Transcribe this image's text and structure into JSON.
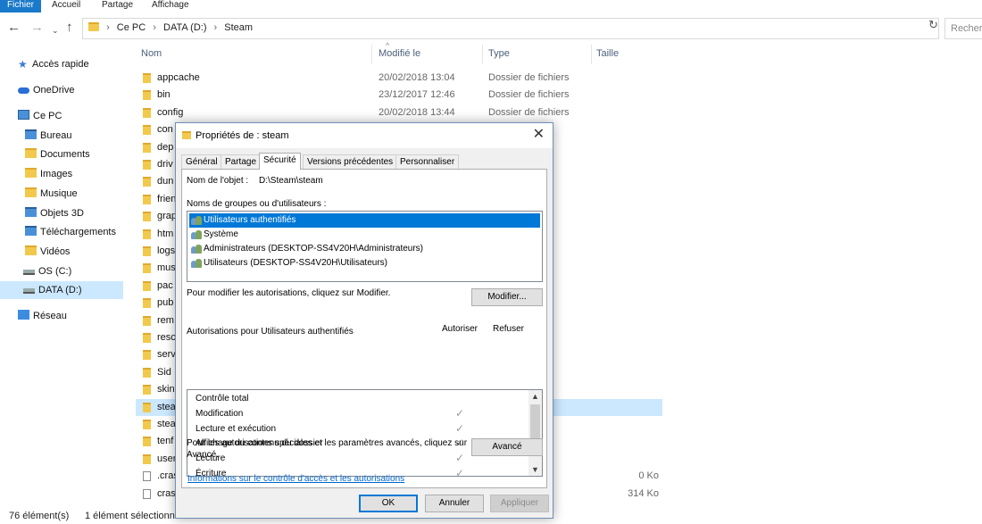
{
  "ribbon": {
    "tabs": [
      "Fichier",
      "Accueil",
      "Partage",
      "Affichage"
    ]
  },
  "address": {
    "crumbs": [
      "Ce PC",
      "DATA (D:)",
      "Steam"
    ],
    "search_placeholder": "Recherc"
  },
  "nav": {
    "items": [
      "Accès rapide",
      "OneDrive",
      "Ce PC",
      "Bureau",
      "Documents",
      "Images",
      "Musique",
      "Objets 3D",
      "Téléchargements",
      "Vidéos",
      "OS (C:)",
      "DATA (D:)",
      "Réseau"
    ]
  },
  "list": {
    "columns": {
      "name": "Nom",
      "modified": "Modifié le",
      "type": "Type",
      "size": "Taille"
    },
    "rows": [
      {
        "name": "appcache",
        "modified": "20/02/2018 13:04",
        "type": "Dossier de fichiers",
        "size": ""
      },
      {
        "name": "bin",
        "modified": "23/12/2017 12:46",
        "type": "Dossier de fichiers",
        "size": ""
      },
      {
        "name": "config",
        "modified": "20/02/2018 13:44",
        "type": "Dossier de fichiers",
        "size": ""
      },
      {
        "name": "con",
        "modified": "",
        "type": "iers",
        "size": ""
      },
      {
        "name": "dep",
        "modified": "",
        "type": "iers",
        "size": ""
      },
      {
        "name": "driv",
        "modified": "",
        "type": "iers",
        "size": ""
      },
      {
        "name": "dun",
        "modified": "",
        "type": "iers",
        "size": ""
      },
      {
        "name": "frien",
        "modified": "",
        "type": "iers",
        "size": ""
      },
      {
        "name": "grap",
        "modified": "",
        "type": "iers",
        "size": ""
      },
      {
        "name": "htm",
        "modified": "",
        "type": "iers",
        "size": ""
      },
      {
        "name": "logs",
        "modified": "",
        "type": "iers",
        "size": ""
      },
      {
        "name": "mus",
        "modified": "",
        "type": "iers",
        "size": ""
      },
      {
        "name": "pac",
        "modified": "",
        "type": "iers",
        "size": ""
      },
      {
        "name": "pub",
        "modified": "",
        "type": "iers",
        "size": ""
      },
      {
        "name": "rem",
        "modified": "",
        "type": "iers",
        "size": ""
      },
      {
        "name": "resc",
        "modified": "",
        "type": "iers",
        "size": ""
      },
      {
        "name": "serv",
        "modified": "",
        "type": "iers",
        "size": ""
      },
      {
        "name": "Sid",
        "modified": "",
        "type": "iers",
        "size": ""
      },
      {
        "name": "skin",
        "modified": "",
        "type": "iers",
        "size": ""
      },
      {
        "name": "stea",
        "modified": "",
        "type": "iers",
        "size": ""
      },
      {
        "name": "stea",
        "modified": "",
        "type": "iers",
        "size": ""
      },
      {
        "name": "tenf",
        "modified": "",
        "type": "iers",
        "size": ""
      },
      {
        "name": "user",
        "modified": "",
        "type": "iers",
        "size": ""
      },
      {
        "name": ".cras",
        "modified": "",
        "type": "",
        "size": "0 Ko"
      },
      {
        "name": "cras",
        "modified": "",
        "type": "pplica...",
        "size": "314 Ko"
      }
    ],
    "selected_index": 19
  },
  "status": {
    "count": "76 élément(s)",
    "selection": "1 élément sélectionné"
  },
  "dialog": {
    "title": "Propriétés de : steam",
    "tabs": [
      "Général",
      "Partage",
      "Sécurité",
      "Versions précédentes",
      "Personnaliser"
    ],
    "active_tab": "Sécurité",
    "object_label": "Nom de l'objet :",
    "object_value": "D:\\Steam\\steam",
    "groups_label": "Noms de groupes ou d'utilisateurs :",
    "users": [
      "Utilisateurs authentifiés",
      "Système",
      "Administrateurs (DESKTOP-SS4V20H\\Administrateurs)",
      "Utilisateurs (DESKTOP-SS4V20H\\Utilisateurs)"
    ],
    "modify_hint": "Pour modifier les autorisations, cliquez sur Modifier.",
    "modify_button": "Modifier...",
    "perms_label": "Autorisations pour Utilisateurs authentifiés",
    "allow_label": "Autoriser",
    "deny_label": "Refuser",
    "permissions": [
      {
        "name": "Contrôle total",
        "allow": false
      },
      {
        "name": "Modification",
        "allow": true
      },
      {
        "name": "Lecture et exécution",
        "allow": true
      },
      {
        "name": "Affichage du contenu du dossier",
        "allow": true
      },
      {
        "name": "Lecture",
        "allow": true
      },
      {
        "name": "Écriture",
        "allow": true
      }
    ],
    "advanced_hint_1": "Pour les autorisations spéciales et les paramètres avancés, cliquez sur",
    "advanced_hint_2": "Avancé.",
    "advanced_button": "Avancé",
    "info_link": "Informations sur le contrôle d'accès et les autorisations",
    "ok": "OK",
    "cancel": "Annuler",
    "apply": "Appliquer"
  }
}
